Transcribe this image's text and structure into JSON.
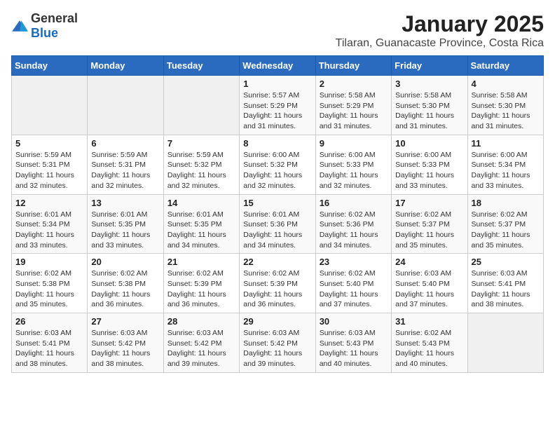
{
  "header": {
    "logo_general": "General",
    "logo_blue": "Blue",
    "title": "January 2025",
    "subtitle": "Tilaran, Guanacaste Province, Costa Rica"
  },
  "weekdays": [
    "Sunday",
    "Monday",
    "Tuesday",
    "Wednesday",
    "Thursday",
    "Friday",
    "Saturday"
  ],
  "weeks": [
    [
      {
        "day": null
      },
      {
        "day": null
      },
      {
        "day": null
      },
      {
        "day": "1",
        "sunrise": "5:57 AM",
        "sunset": "5:29 PM",
        "daylight": "11 hours and 31 minutes."
      },
      {
        "day": "2",
        "sunrise": "5:58 AM",
        "sunset": "5:29 PM",
        "daylight": "11 hours and 31 minutes."
      },
      {
        "day": "3",
        "sunrise": "5:58 AM",
        "sunset": "5:30 PM",
        "daylight": "11 hours and 31 minutes."
      },
      {
        "day": "4",
        "sunrise": "5:58 AM",
        "sunset": "5:30 PM",
        "daylight": "11 hours and 31 minutes."
      }
    ],
    [
      {
        "day": "5",
        "sunrise": "5:59 AM",
        "sunset": "5:31 PM",
        "daylight": "11 hours and 32 minutes."
      },
      {
        "day": "6",
        "sunrise": "5:59 AM",
        "sunset": "5:31 PM",
        "daylight": "11 hours and 32 minutes."
      },
      {
        "day": "7",
        "sunrise": "5:59 AM",
        "sunset": "5:32 PM",
        "daylight": "11 hours and 32 minutes."
      },
      {
        "day": "8",
        "sunrise": "6:00 AM",
        "sunset": "5:32 PM",
        "daylight": "11 hours and 32 minutes."
      },
      {
        "day": "9",
        "sunrise": "6:00 AM",
        "sunset": "5:33 PM",
        "daylight": "11 hours and 32 minutes."
      },
      {
        "day": "10",
        "sunrise": "6:00 AM",
        "sunset": "5:33 PM",
        "daylight": "11 hours and 33 minutes."
      },
      {
        "day": "11",
        "sunrise": "6:00 AM",
        "sunset": "5:34 PM",
        "daylight": "11 hours and 33 minutes."
      }
    ],
    [
      {
        "day": "12",
        "sunrise": "6:01 AM",
        "sunset": "5:34 PM",
        "daylight": "11 hours and 33 minutes."
      },
      {
        "day": "13",
        "sunrise": "6:01 AM",
        "sunset": "5:35 PM",
        "daylight": "11 hours and 33 minutes."
      },
      {
        "day": "14",
        "sunrise": "6:01 AM",
        "sunset": "5:35 PM",
        "daylight": "11 hours and 34 minutes."
      },
      {
        "day": "15",
        "sunrise": "6:01 AM",
        "sunset": "5:36 PM",
        "daylight": "11 hours and 34 minutes."
      },
      {
        "day": "16",
        "sunrise": "6:02 AM",
        "sunset": "5:36 PM",
        "daylight": "11 hours and 34 minutes."
      },
      {
        "day": "17",
        "sunrise": "6:02 AM",
        "sunset": "5:37 PM",
        "daylight": "11 hours and 35 minutes."
      },
      {
        "day": "18",
        "sunrise": "6:02 AM",
        "sunset": "5:37 PM",
        "daylight": "11 hours and 35 minutes."
      }
    ],
    [
      {
        "day": "19",
        "sunrise": "6:02 AM",
        "sunset": "5:38 PM",
        "daylight": "11 hours and 35 minutes."
      },
      {
        "day": "20",
        "sunrise": "6:02 AM",
        "sunset": "5:38 PM",
        "daylight": "11 hours and 36 minutes."
      },
      {
        "day": "21",
        "sunrise": "6:02 AM",
        "sunset": "5:39 PM",
        "daylight": "11 hours and 36 minutes."
      },
      {
        "day": "22",
        "sunrise": "6:02 AM",
        "sunset": "5:39 PM",
        "daylight": "11 hours and 36 minutes."
      },
      {
        "day": "23",
        "sunrise": "6:02 AM",
        "sunset": "5:40 PM",
        "daylight": "11 hours and 37 minutes."
      },
      {
        "day": "24",
        "sunrise": "6:03 AM",
        "sunset": "5:40 PM",
        "daylight": "11 hours and 37 minutes."
      },
      {
        "day": "25",
        "sunrise": "6:03 AM",
        "sunset": "5:41 PM",
        "daylight": "11 hours and 38 minutes."
      }
    ],
    [
      {
        "day": "26",
        "sunrise": "6:03 AM",
        "sunset": "5:41 PM",
        "daylight": "11 hours and 38 minutes."
      },
      {
        "day": "27",
        "sunrise": "6:03 AM",
        "sunset": "5:42 PM",
        "daylight": "11 hours and 38 minutes."
      },
      {
        "day": "28",
        "sunrise": "6:03 AM",
        "sunset": "5:42 PM",
        "daylight": "11 hours and 39 minutes."
      },
      {
        "day": "29",
        "sunrise": "6:03 AM",
        "sunset": "5:42 PM",
        "daylight": "11 hours and 39 minutes."
      },
      {
        "day": "30",
        "sunrise": "6:03 AM",
        "sunset": "5:43 PM",
        "daylight": "11 hours and 40 minutes."
      },
      {
        "day": "31",
        "sunrise": "6:02 AM",
        "sunset": "5:43 PM",
        "daylight": "11 hours and 40 minutes."
      },
      {
        "day": null
      }
    ]
  ],
  "labels": {
    "sunrise": "Sunrise:",
    "sunset": "Sunset:",
    "daylight": "Daylight:"
  },
  "colors": {
    "header_bg": "#2a6bbf",
    "accent": "#1a6bbf"
  }
}
